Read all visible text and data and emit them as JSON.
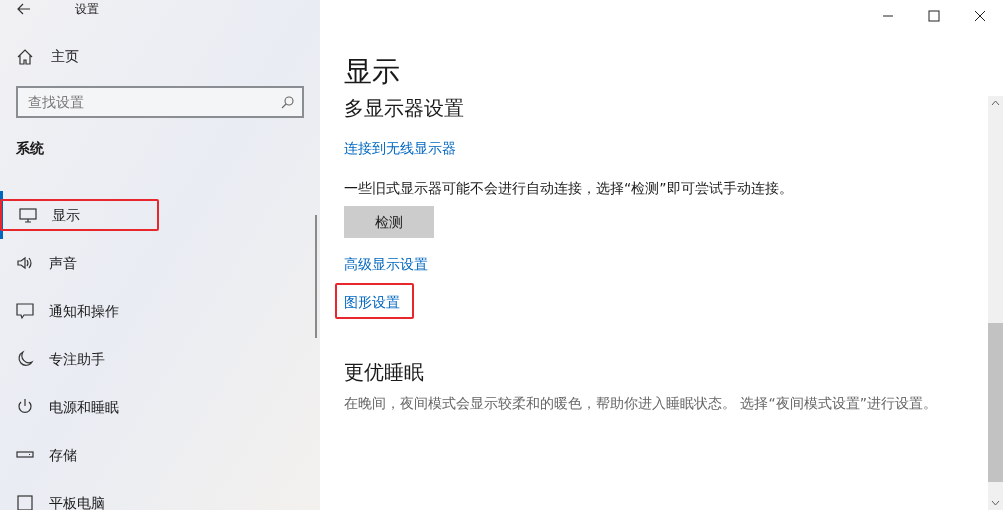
{
  "window": {
    "title": "设置"
  },
  "sidebar": {
    "home": "主页",
    "search": {
      "placeholder": "查找设置"
    },
    "section": "系统",
    "items": [
      {
        "label": "显示",
        "kind": "monitor",
        "selected": true,
        "highlighted": true
      },
      {
        "label": "声音",
        "kind": "speaker",
        "selected": false,
        "highlighted": false
      },
      {
        "label": "通知和操作",
        "kind": "message",
        "selected": false,
        "highlighted": false
      },
      {
        "label": "专注助手",
        "kind": "moon",
        "selected": false,
        "highlighted": false
      },
      {
        "label": "电源和睡眠",
        "kind": "power",
        "selected": false,
        "highlighted": false
      },
      {
        "label": "存储",
        "kind": "storage",
        "selected": false,
        "highlighted": false
      },
      {
        "label": "平板电脑",
        "kind": "tablet",
        "selected": false,
        "highlighted": false
      }
    ]
  },
  "page": {
    "title": "显示",
    "sections": [
      {
        "heading": "多显示器设置",
        "blocks": [
          {
            "kind": "link",
            "text": "连接到无线显示器",
            "highlighted": false
          },
          {
            "kind": "text",
            "text": "一些旧式显示器可能不会进行自动连接，选择“检测”即可尝试手动连接。"
          },
          {
            "kind": "button",
            "text": "检测"
          },
          {
            "kind": "link",
            "text": "高级显示设置",
            "highlighted": false
          },
          {
            "kind": "link",
            "text": "图形设置",
            "highlighted": true
          }
        ]
      },
      {
        "heading": "更优睡眠",
        "blocks": [
          {
            "kind": "note",
            "text": "在晚间，夜间模式会显示较柔和的暖色，帮助你进入睡眠状态。 选择“夜间模式设置”进行设置。"
          }
        ]
      }
    ]
  }
}
